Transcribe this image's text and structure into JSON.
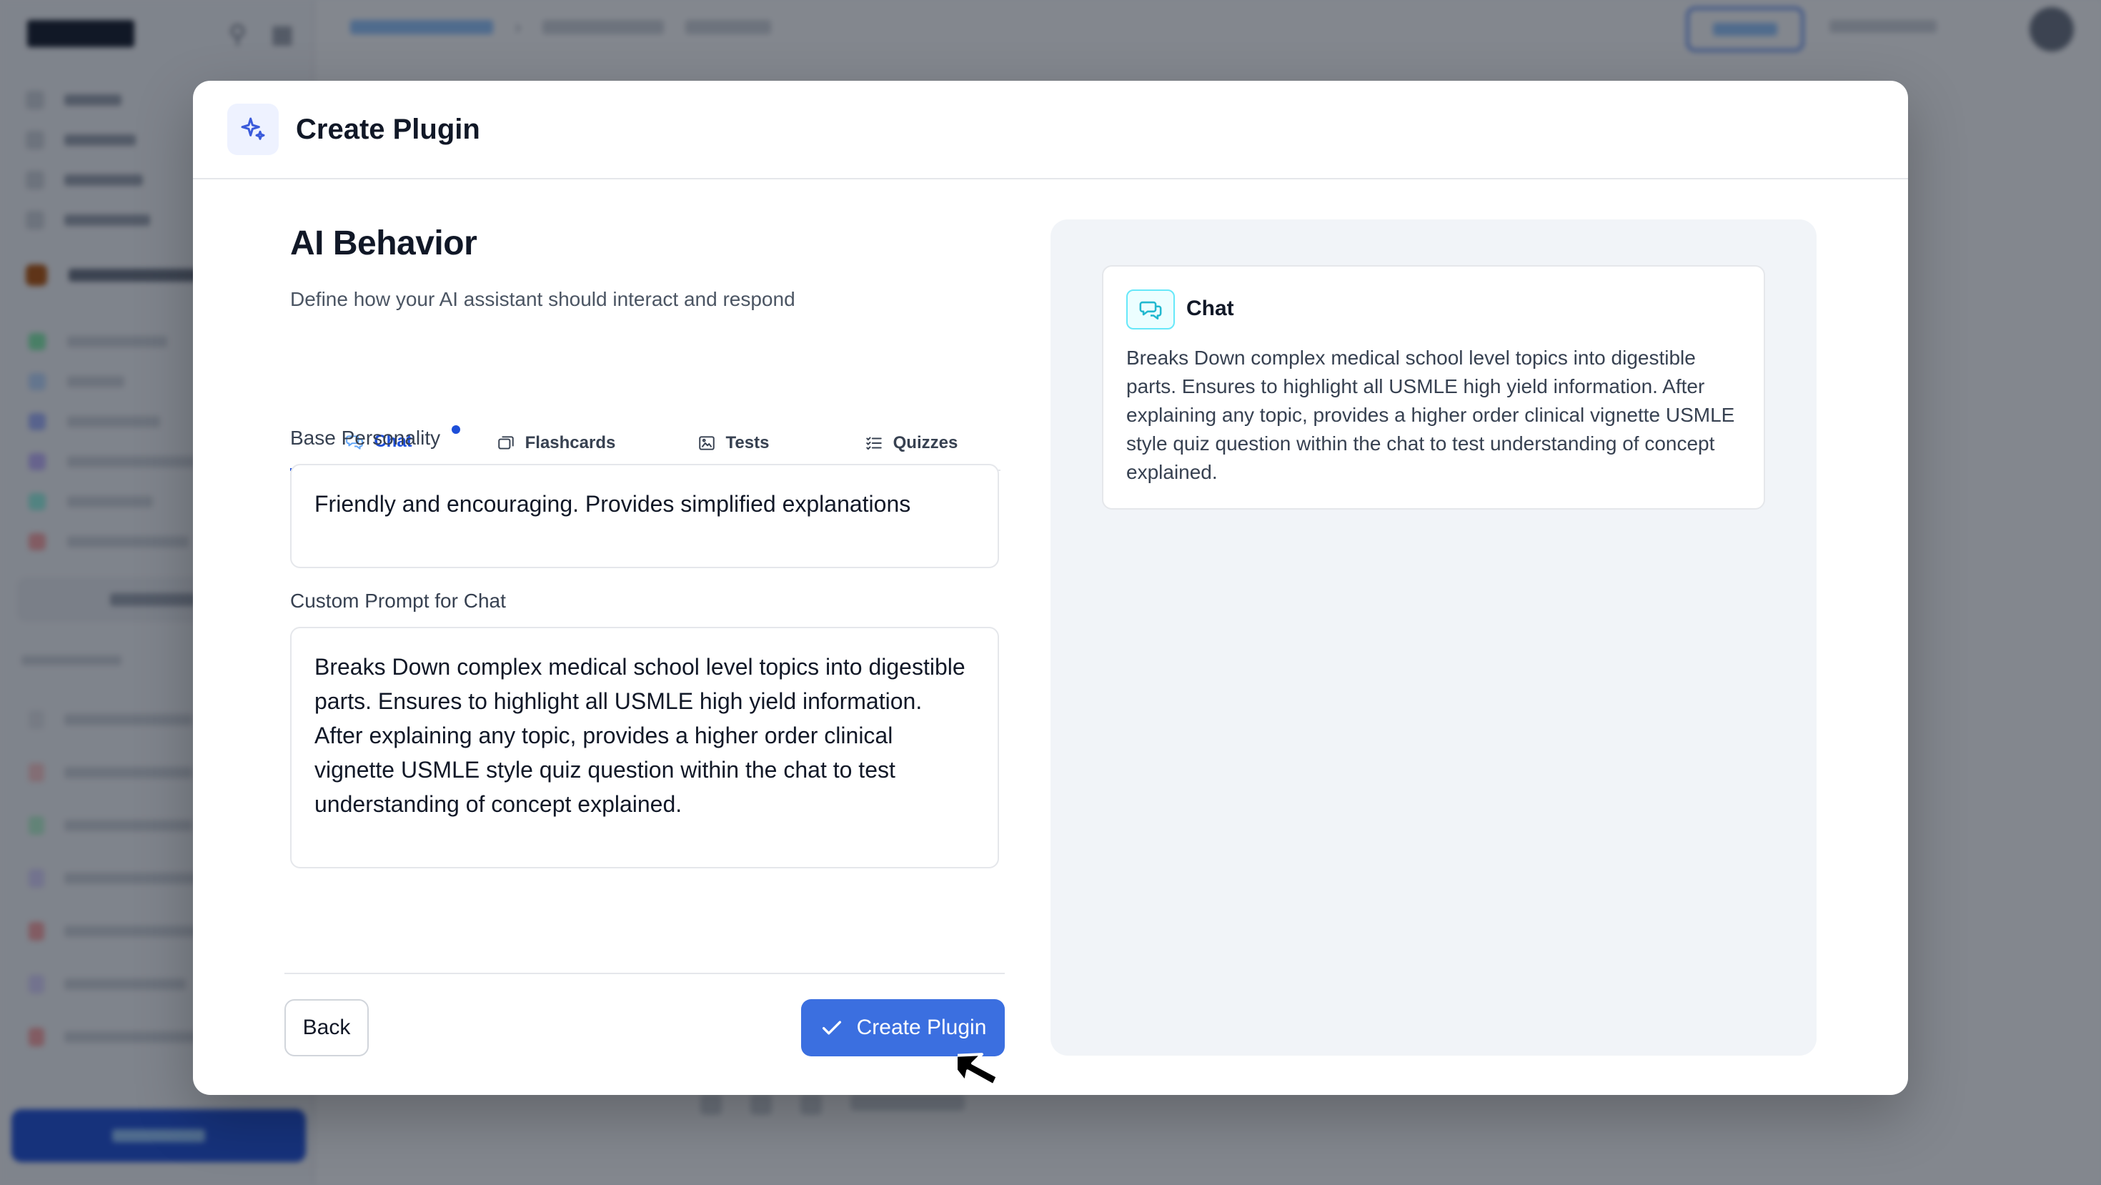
{
  "modal": {
    "title": "Create Plugin",
    "section_title": "AI Behavior",
    "section_subtitle": "Define how your AI assistant should interact and respond",
    "tabs": [
      {
        "label": "Chat",
        "icon": "chat-icon",
        "active": true
      },
      {
        "label": "Flashcards",
        "icon": "flashcards-icon",
        "active": false
      },
      {
        "label": "Tests",
        "icon": "image-icon",
        "active": false
      },
      {
        "label": "Quizzes",
        "icon": "checklist-icon",
        "active": false
      }
    ],
    "fields": {
      "base_personality_label": "Base Personality",
      "base_personality_value": "Friendly and encouraging. Provides simplified explanations",
      "custom_prompt_label": "Custom Prompt for Chat",
      "custom_prompt_value": "Breaks Down complex medical school level topics into digestible parts. Ensures to highlight all USMLE high yield information. After explaining any topic, provides a higher order clinical vignette USMLE style quiz question within the chat to test understanding of concept explained."
    },
    "buttons": {
      "back": "Back",
      "create": "Create Plugin"
    },
    "preview": {
      "title": "Chat",
      "text": "Breaks Down complex medical school level topics into digestible parts. Ensures to highlight all USMLE high yield information. After explaining any topic, provides a higher order clinical vignette USMLE style quiz question within the chat to test understanding of concept explained."
    }
  },
  "colors": {
    "accent": "#3b6fe0",
    "active_tab": "#1d4ed8",
    "preview_bg": "#f1f4f8",
    "overlay": "rgba(17,24,39,0.52)"
  }
}
